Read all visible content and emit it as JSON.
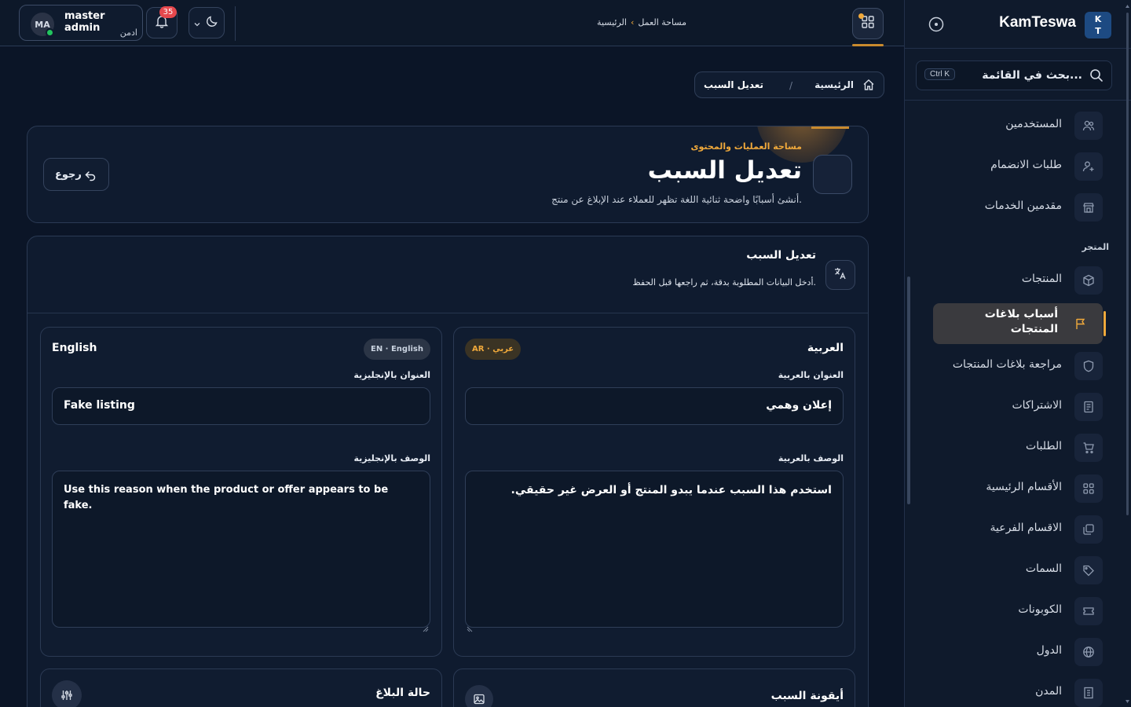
{
  "sidebar": {
    "brand_name": "KamTeswa",
    "brand_logo_line1": "K",
    "brand_logo_line2": "T",
    "search_placeholder": "بحث في القائمة...",
    "search_shortcut": "Ctrl K",
    "section_store": "المتجر",
    "items": [
      {
        "label": "المستخدمين",
        "icon": "users-icon"
      },
      {
        "label": "طلبات الانضمام",
        "icon": "user-plus-icon"
      },
      {
        "label": "مقدمين الخدمات",
        "icon": "store-icon"
      },
      {
        "label": "المنتجات",
        "icon": "box-icon"
      },
      {
        "label": "أسباب بلاغات المنتجات",
        "icon": "flag-icon",
        "active": true
      },
      {
        "label": "مراجعة بلاغات المنتجات",
        "icon": "shield-icon"
      },
      {
        "label": "الاشتراكات",
        "icon": "receipt-icon"
      },
      {
        "label": "الطلبات",
        "icon": "cart-icon"
      },
      {
        "label": "الأقسام الرئيسية",
        "icon": "grid-icon"
      },
      {
        "label": "الاقسام الفرعية",
        "icon": "layers-icon"
      },
      {
        "label": "السمات",
        "icon": "tag-icon"
      },
      {
        "label": "الكوبونات",
        "icon": "ticket-icon"
      },
      {
        "label": "الدول",
        "icon": "globe-icon"
      },
      {
        "label": "المدن",
        "icon": "building-icon"
      }
    ]
  },
  "topbar": {
    "user_initials": "MA",
    "user_name": "master admin",
    "user_role": "ادمن",
    "notification_count": "35",
    "breadcrumb_home": "الرئيسية",
    "breadcrumb_workspace": "مساحة العمل"
  },
  "page_breadcrumb": {
    "home": "الرئيسية",
    "current": "تعديل السبب"
  },
  "header": {
    "eyebrow": "مساحة العمليات والمحتوى",
    "title": "تعديل السبب",
    "subtitle": "أنشئ أسبابًا واضحة ثنائية اللغة تظهر للعملاء عند الإبلاغ عن منتج.",
    "back_label": "رجوع"
  },
  "form": {
    "title": "تعديل السبب",
    "subtitle": "أدخل البيانات المطلوبة بدقة، ثم راجعها قبل الحفظ.",
    "arabic": {
      "panel_title": "العربية",
      "badge": "AR · عربي",
      "title_label": "العنوان بالعربية",
      "title_value": "إعلان وهمي",
      "description_label": "الوصف بالعربية",
      "description_value": "استخدم هذا السبب عندما يبدو المنتج أو العرض غير حقيقي."
    },
    "english": {
      "panel_title": "English",
      "badge": "EN · English",
      "title_label": "العنوان بالإنجليزية",
      "title_value": "Fake listing",
      "description_label": "الوصف بالإنجليزية",
      "description_value": "Use this reason when the product or offer appears to be fake."
    },
    "icon_section_title": "أيقونة السبب",
    "status_section_title": "حالة البلاغ"
  },
  "colors": {
    "background": "#0b1527",
    "accent": "#f0a93b",
    "online": "#22c55e",
    "badge_red": "#e5484d"
  }
}
